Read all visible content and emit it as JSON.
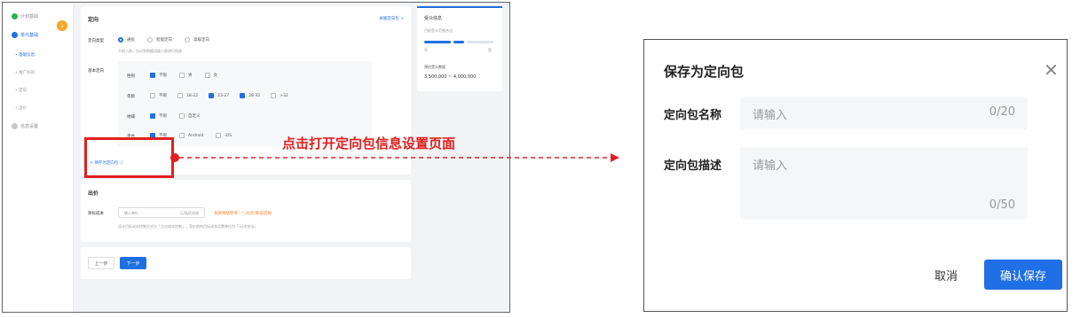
{
  "sidebar": {
    "steps": [
      {
        "label": "计划基础",
        "state": "done"
      },
      {
        "label": "单元基础",
        "state": "active"
      },
      {
        "label": "信息设置",
        "state": "todo"
      }
    ],
    "sub_items": [
      "基础信息",
      "推广标的",
      "定向",
      "出价"
    ]
  },
  "targeting": {
    "section_title": "定向",
    "link": "关联定向包 >",
    "type_label": "定向类型",
    "type_options": [
      "通投",
      "智能定向",
      "高级定向"
    ],
    "hint": "不限人群，由计划根据流量人群进行投放",
    "basic_label": "基本定向",
    "rows": [
      {
        "label": "性别",
        "options": [
          {
            "t": "不限",
            "on": true
          },
          {
            "t": "男",
            "on": false
          },
          {
            "t": "女",
            "on": false
          }
        ]
      },
      {
        "label": "年龄",
        "options": [
          {
            "t": "不限",
            "on": false
          },
          {
            "t": "18-22",
            "on": false
          },
          {
            "t": "23-27",
            "on": true
          },
          {
            "t": "28-32",
            "on": true
          },
          {
            "t": ">32",
            "on": false
          }
        ]
      },
      {
        "label": "地域",
        "options": [
          {
            "t": "不限",
            "on": true
          },
          {
            "t": "自定义",
            "on": false
          }
        ]
      },
      {
        "label": "平台",
        "options": [
          {
            "t": "不限",
            "on": true
          },
          {
            "t": "Android",
            "on": false
          },
          {
            "t": "iOS",
            "on": false
          }
        ]
      }
    ],
    "save_pkg": "+ 保存为定向包 ⓘ"
  },
  "audience": {
    "title": "受众信息",
    "sub": "目前受众范围合适",
    "left": "窄",
    "right": "宽",
    "est_label": "预估受众数据",
    "est_value": "3,500,000 ~ 4,000,000"
  },
  "bid": {
    "title": "出价",
    "target_label": "目标成本",
    "input_ph": "输入单价",
    "unit": "元/私信咨询",
    "suggest": "系统预估参考：*.20元/私信咨询",
    "hint": "设计目标成本控制方式为「点击成本控制」，竞价前的目标成本设置单位为「元/次合法」"
  },
  "footer": {
    "prev": "上一步",
    "next": "下一步"
  },
  "step_badge": "1",
  "annotation": "点击打开定向包信息设置页面",
  "dialog": {
    "title": "保存为定向包",
    "close_icon": "close-icon",
    "name_label": "定向包名称",
    "name_placeholder": "请输入",
    "name_count": "0/20",
    "desc_label": "定向包描述",
    "desc_placeholder": "请输入",
    "desc_count": "0/50",
    "cancel": "取消",
    "confirm": "确认保存"
  },
  "colors": {
    "accent": "#1f6fe5",
    "annotation": "#e02020",
    "badge": "#f5a623"
  }
}
